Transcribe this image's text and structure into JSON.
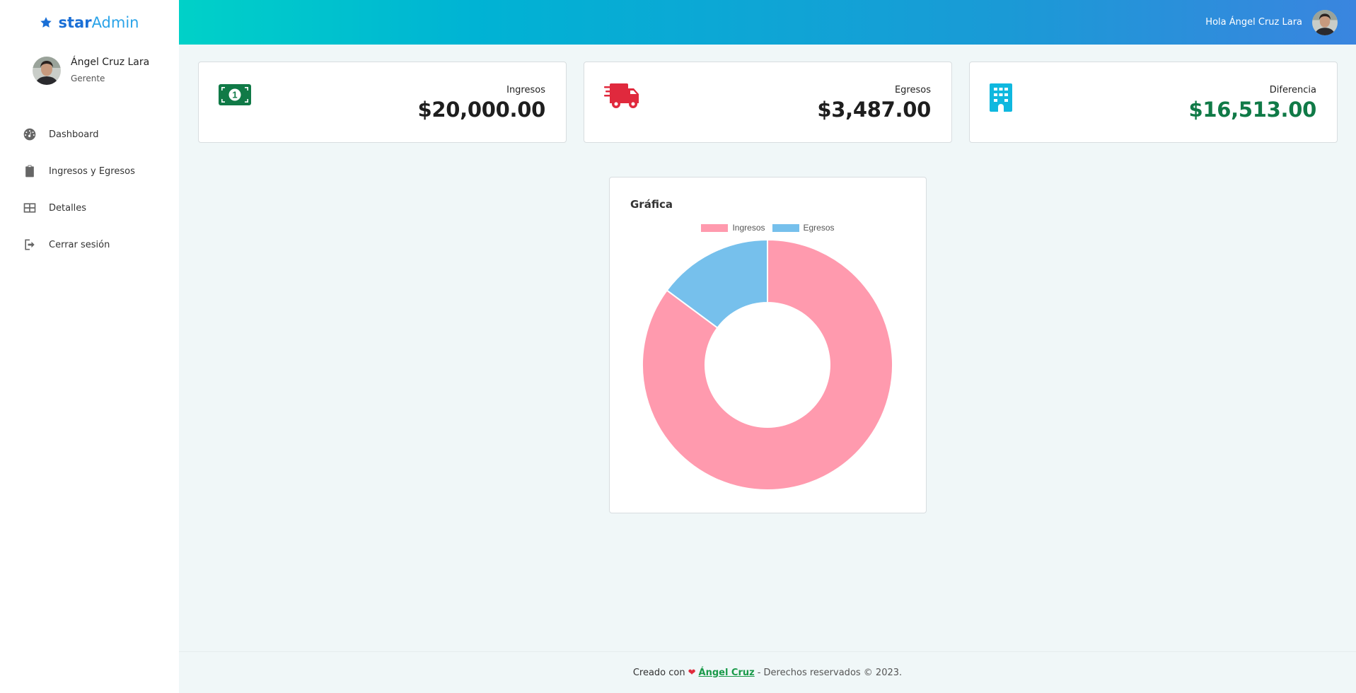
{
  "brand": {
    "part1": "star",
    "part2": "Admin"
  },
  "user": {
    "name": "Ángel Cruz Lara",
    "role": "Gerente"
  },
  "header": {
    "greeting": "Hola Ángel Cruz Lara"
  },
  "nav": [
    {
      "label": "Dashboard",
      "icon": "dashboard-icon"
    },
    {
      "label": "Ingresos y Egresos",
      "icon": "clipboard-icon"
    },
    {
      "label": "Detalles",
      "icon": "table-icon"
    },
    {
      "label": "Cerrar sesión",
      "icon": "logout-icon"
    }
  ],
  "cards": [
    {
      "label": "Ingresos",
      "value": "$20,000.00",
      "icon": "money-bill-icon",
      "color": "#107a47"
    },
    {
      "label": "Egresos",
      "value": "$3,487.00",
      "icon": "truck-icon",
      "color": "#e0293d"
    },
    {
      "label": "Diferencia",
      "value": "$16,513.00",
      "icon": "building-icon",
      "color": "#0fb8df"
    }
  ],
  "chart_panel": {
    "title": "Gráfica"
  },
  "chart_data": {
    "type": "pie",
    "categories": [
      "Ingresos",
      "Egresos"
    ],
    "values": [
      20000,
      3487
    ],
    "colors": [
      "#ff9aae",
      "#76c0ec"
    ],
    "legend": "top"
  },
  "footer": {
    "prefix": "Creado con",
    "heart": "❤",
    "author": "Ángel Cruz",
    "suffix": "- Derechos reservados © 2023."
  }
}
